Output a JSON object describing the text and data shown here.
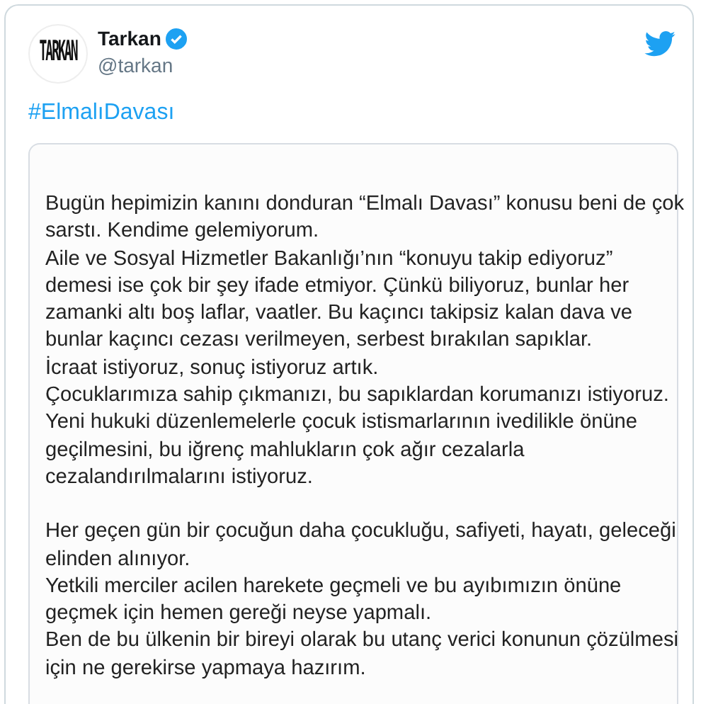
{
  "tweet": {
    "author": {
      "name": "Tarkan",
      "handle": "@tarkan",
      "verified": true,
      "avatar_logo": "TARKAN"
    },
    "hashtag": "#ElmalıDavası",
    "document": {
      "paragraphs": [
        {
          "lines": [
            "Bugün hepimizin kanını donduran “Elmalı Davası” konusu beni de çok",
            "sarstı. Kendime gelemiyorum.",
            "Aile ve Sosyal Hizmetler Bakanlığı’nın “konuyu takip ediyoruz”",
            "demesi ise çok bir şey ifade etmiyor. Çünkü biliyoruz, bunlar her",
            "zamanki altı boş laflar, vaatler. Bu kaçıncı takipsiz kalan dava ve",
            "bunlar kaçıncı cezası verilmeyen, serbest bırakılan sapıklar.",
            "İcraat istiyoruz, sonuç istiyoruz artık.",
            "Çocuklarımıza sahip çıkmanızı, bu sapıklardan korumanızı istiyoruz.",
            "Yeni hukuki düzenlemelerle çocuk istismarlarının ivedilikle önüne",
            "geçilmesini, bu iğrenç mahlukların çok ağır cezalarla",
            "cezalandırılmalarını istiyoruz."
          ]
        },
        {
          "lines": [
            "Her geçen gün bir çocuğun daha çocukluğu, safiyeti, hayatı, geleceği",
            "elinden alınıyor.",
            "Yetkili merciler acilen harekete geçmeli ve bu ayıbımızın önüne",
            "geçmek için hemen gereği neyse yapmalı.",
            "Ben de bu ülkenin bir bireyi olarak bu utanç verici konunun çözülmesi",
            "için ne gerekirse yapmaya hazırım."
          ]
        }
      ]
    }
  }
}
